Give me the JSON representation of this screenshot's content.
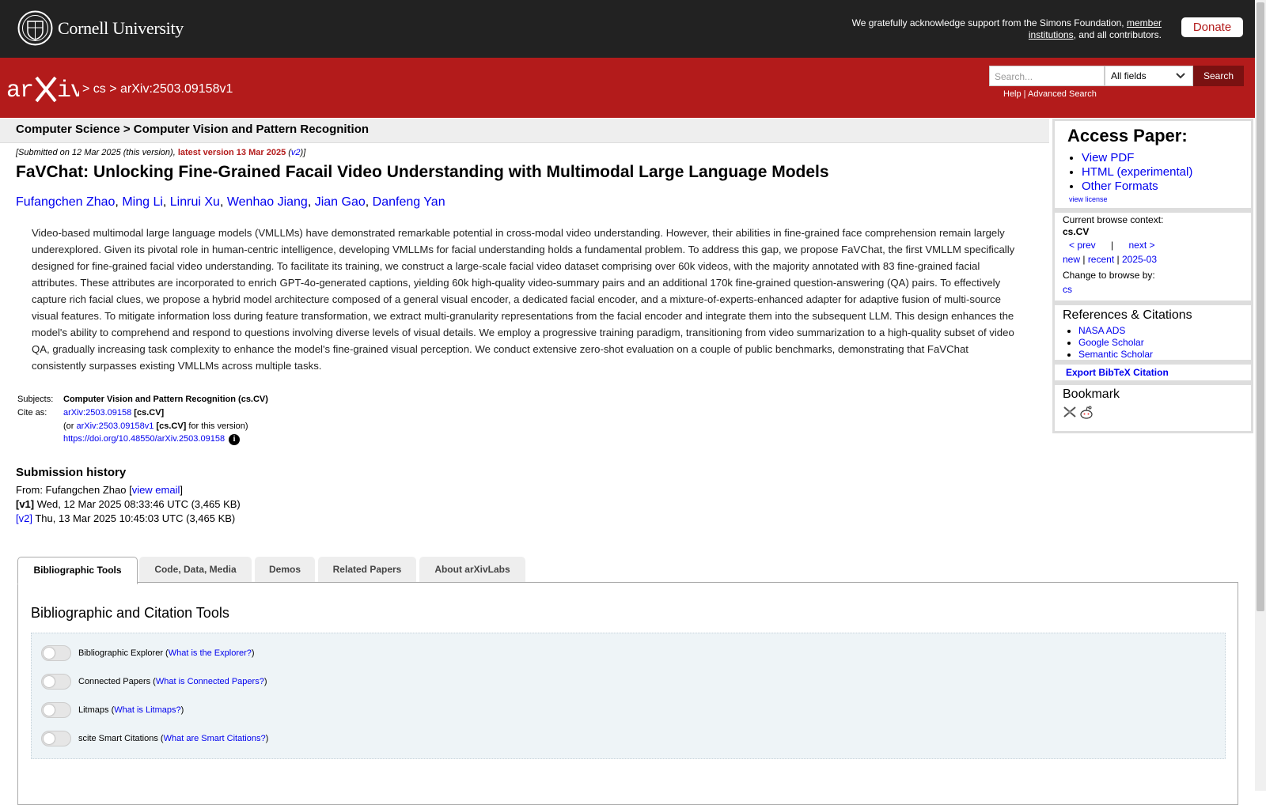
{
  "header": {
    "university": "Cornell University",
    "ack_text": "We gratefully acknowledge support from the Simons Foundation,",
    "ack_link": "member institutions",
    "ack_tail": ", and all contributors.",
    "donate": "Donate"
  },
  "nav": {
    "crumb_sep1": "> ",
    "crumb_cs": "cs",
    "crumb_sep2": " > ",
    "crumb_id": "arXiv:2503.09158v1",
    "search_placeholder": "Search...",
    "search_field": "All fields",
    "search_button": "Search",
    "help": "Help",
    "help_sep": " | ",
    "advanced": "Advanced Search"
  },
  "paper": {
    "category": "Computer Science > Computer Vision and Pattern Recognition",
    "submitted": "[Submitted on 12 Mar 2025 (this version), ",
    "latest": "latest version 13 Mar 2025",
    "latest_open": " (",
    "latest_link": "v2",
    "latest_close": ")]",
    "title": "FaVChat: Unlocking Fine-Grained Facail Video Understanding with Multimodal Large Language Models",
    "authors": [
      "Fufangchen Zhao",
      "Ming Li",
      "Linrui Xu",
      "Wenhao Jiang",
      "Jian Gao",
      "Danfeng Yan"
    ],
    "abstract": "Video-based multimodal large language models (VMLLMs) have demonstrated remarkable potential in cross-modal video understanding. However, their abilities in fine-grained face comprehension remain largely underexplored. Given its pivotal role in human-centric intelligence, developing VMLLMs for facial understanding holds a fundamental problem. To address this gap, we propose FaVChat, the first VMLLM specifically designed for fine-grained facial video understanding. To facilitate its training, we construct a large-scale facial video dataset comprising over 60k videos, with the majority annotated with 83 fine-grained facial attributes. These attributes are incorporated to enrich GPT-4o-generated captions, yielding 60k high-quality video-summary pairs and an additional 170k fine-grained question-answering (QA) pairs. To effectively capture rich facial clues, we propose a hybrid model architecture composed of a general visual encoder, a dedicated facial encoder, and a mixture-of-experts-enhanced adapter for adaptive fusion of multi-source visual features. To mitigate information loss during feature transformation, we extract multi-granularity representations from the facial encoder and integrate them into the subsequent LLM. This design enhances the model's ability to comprehend and respond to questions involving diverse levels of visual details. We employ a progressive training paradigm, transitioning from video summarization to a high-quality subset of video QA, gradually increasing task complexity to enhance the model's fine-grained visual perception. We conduct extensive zero-shot evaluation on a couple of public benchmarks, demonstrating that FaVChat consistently surpasses existing VMLLMs across multiple tasks.",
    "subjects_label": "Subjects:",
    "subjects": "Computer Vision and Pattern Recognition (cs.CV)",
    "cite_label": "Cite as:",
    "cite_id": "arXiv:2503.09158",
    "cite_cat": "[cs.CV]",
    "cite_open": "(or ",
    "cite_v1": "arXiv:2503.09158v1",
    "cite_v1_cat": "[cs.CV]",
    "cite_tail": " for this version)",
    "doi": "https://doi.org/10.48550/arXiv.2503.09158",
    "info_icon": "i"
  },
  "history": {
    "title": "Submission history",
    "from": "From: Fufangchen Zhao [",
    "view_email": "view email",
    "from_close": "]",
    "v1_label": "[v1]",
    "v1": " Wed, 12 Mar 2025 08:33:46 UTC (3,465 KB)",
    "v2_label": "[v2]",
    "v2": " Thu, 13 Mar 2025 10:45:03 UTC (3,465 KB)"
  },
  "tabs": [
    "Bibliographic Tools",
    "Code, Data, Media",
    "Demos",
    "Related Papers",
    "About arXivLabs"
  ],
  "tools": {
    "heading": "Bibliographic and Citation Tools",
    "items": [
      {
        "label": "Bibliographic Explorer (",
        "link": "What is the Explorer?",
        "close": ")"
      },
      {
        "label": "Connected Papers (",
        "link": "What is Connected Papers?",
        "close": ")"
      },
      {
        "label": "Litmaps (",
        "link": "What is Litmaps?",
        "close": ")"
      },
      {
        "label": "scite Smart Citations (",
        "link": "What are Smart Citations?",
        "close": ")"
      }
    ]
  },
  "sidebar": {
    "access_title": "Access Paper:",
    "access_links": [
      "View PDF",
      "HTML (experimental)",
      "Other Formats"
    ],
    "view_license": "view license",
    "context_label": "Current browse context:",
    "context": "cs.CV",
    "prev": "< prev",
    "pipe": "|",
    "next": "next >",
    "new": "new",
    "recent": "recent",
    "month": "2025-03",
    "change_label": "Change to browse by:",
    "change_cs": "cs",
    "refs_title": "References & Citations",
    "refs": [
      "NASA ADS",
      "Google Scholar",
      "Semantic Scholar"
    ],
    "export": "Export BibTeX Citation",
    "bookmark": "Bookmark"
  },
  "colors": {
    "arxiv_red": "#b31b1b",
    "top_black": "#222222",
    "link": "#0000ee"
  }
}
